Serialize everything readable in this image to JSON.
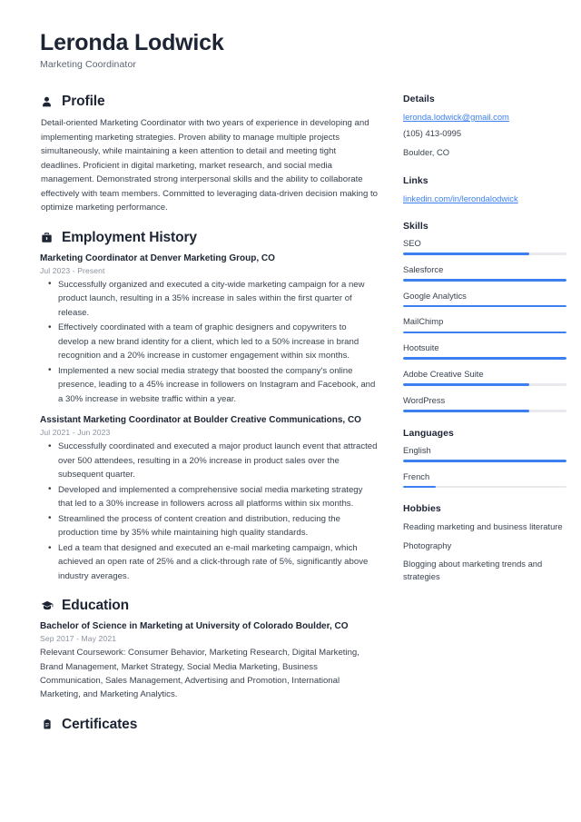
{
  "header": {
    "name": "Leronda Lodwick",
    "job_title": "Marketing Coordinator"
  },
  "accent_color": "#3b7ff0",
  "heading_color": "#1d2433",
  "text_color": "#3a4250",
  "sections": {
    "profile": {
      "icon": "person-icon",
      "title": "Profile",
      "text": "Detail-oriented Marketing Coordinator with two years of experience in developing and implementing marketing strategies. Proven ability to manage multiple projects simultaneously, while maintaining a keen attention to detail and meeting tight deadlines. Proficient in digital marketing, market research, and social media management. Demonstrated strong interpersonal skills and the ability to collaborate effectively with team members. Committed to leveraging data-driven decision making to optimize marketing performance."
    },
    "employment": {
      "icon": "briefcase-icon",
      "title": "Employment History",
      "entries": [
        {
          "title": "Marketing Coordinator at Denver Marketing Group, CO",
          "date": "Jul 2023 - Present",
          "bullets": [
            "Successfully organized and executed a city-wide marketing campaign for a new product launch, resulting in a 35% increase in sales within the first quarter of release.",
            "Effectively coordinated with a team of graphic designers and copywriters to develop a new brand identity for a client, which led to a 50% increase in brand recognition and a 20% increase in customer engagement within six months.",
            "Implemented a new social media strategy that boosted the company's online presence, leading to a 45% increase in followers on Instagram and Facebook, and a 30% increase in website traffic within a year."
          ]
        },
        {
          "title": "Assistant Marketing Coordinator at Boulder Creative Communications, CO",
          "date": "Jul 2021 - Jun 2023",
          "bullets": [
            "Successfully coordinated and executed a major product launch event that attracted over 500 attendees, resulting in a 20% increase in product sales over the subsequent quarter.",
            "Developed and implemented a comprehensive social media marketing strategy that led to a 30% increase in followers across all platforms within six months.",
            "Streamlined the process of content creation and distribution, reducing the production time by 35% while maintaining high quality standards.",
            "Led a team that designed and executed an e-mail marketing campaign, which achieved an open rate of 25% and a click-through rate of 5%, significantly above industry averages."
          ]
        }
      ]
    },
    "education": {
      "icon": "graduation-cap-icon",
      "title": "Education",
      "entries": [
        {
          "title": "Bachelor of Science in Marketing at University of Colorado Boulder, CO",
          "date": "Sep 2017 - May 2021",
          "description": "Relevant Coursework: Consumer Behavior, Marketing Research, Digital Marketing, Brand Management, Market Strategy, Social Media Marketing, Business Communication, Sales Management, Advertising and Promotion, International Marketing, and Marketing Analytics."
        }
      ]
    },
    "certificates": {
      "icon": "clipboard-icon",
      "title": "Certificates"
    }
  },
  "sidebar": {
    "details": {
      "title": "Details",
      "email": "leronda.lodwick@gmail.com",
      "phone": "(105) 413-0995",
      "location": "Boulder, CO"
    },
    "links": {
      "title": "Links",
      "items": [
        {
          "label": "linkedin.com/in/lerondalodwick"
        }
      ]
    },
    "skills": {
      "title": "Skills",
      "items": [
        {
          "label": "SEO",
          "level": 77
        },
        {
          "label": "Salesforce",
          "level": 100
        },
        {
          "label": "Google Analytics",
          "level": 100
        },
        {
          "label": "MailChimp",
          "level": 100
        },
        {
          "label": "Hootsuite",
          "level": 100
        },
        {
          "label": "Adobe Creative Suite",
          "level": 77
        },
        {
          "label": "WordPress",
          "level": 77
        }
      ]
    },
    "languages": {
      "title": "Languages",
      "items": [
        {
          "label": "English",
          "level": 100
        },
        {
          "label": "French",
          "level": 20
        }
      ]
    },
    "hobbies": {
      "title": "Hobbies",
      "items": [
        {
          "label": "Reading marketing and business literature"
        },
        {
          "label": "Photography"
        },
        {
          "label": "Blogging about marketing trends and strategies"
        }
      ]
    }
  }
}
